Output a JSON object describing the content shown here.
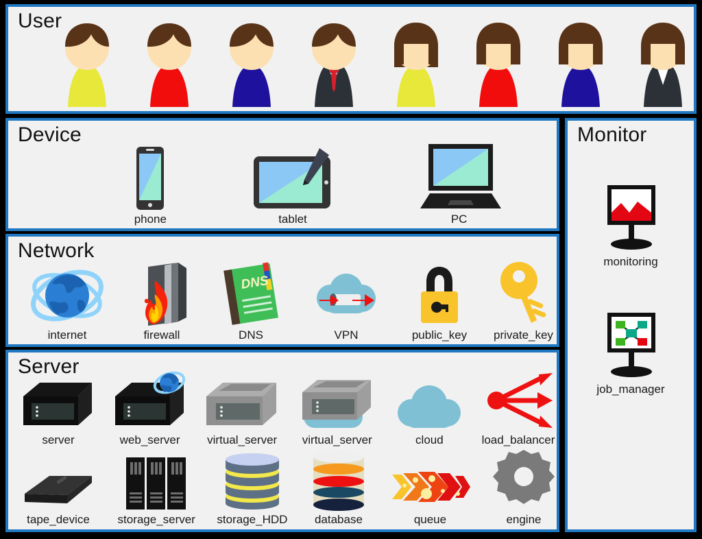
{
  "colors": {
    "background": "#000000",
    "panel_fill": "#F1F1F1",
    "panel_border": "#1F78C1",
    "label_text": "#1A1A1A",
    "skin": "#FCE0B2",
    "hair": "#593318",
    "shirt_yellow": "#E8E83A",
    "shirt_red": "#F20D0D",
    "shirt_blue": "#1E119E",
    "suit_dark": "#2B3137",
    "tie_red": "#D8202A",
    "screen_green": "#9BEBD2",
    "screen_blue": "#8CC8F5",
    "device_dark": "#333333",
    "key_yellow": "#F9C32B",
    "cloud_blue": "#7FC0D4",
    "arrow_red": "#EE1111",
    "gear_gray": "#7A7A7A",
    "hdd_slate": "#5D7085",
    "hdd_yellow": "#F2E84B",
    "chart_red": "#E30613",
    "node_green": "#3CB521",
    "node_teal": "#0BA888"
  },
  "panels": [
    {
      "id": "user",
      "title": "User"
    },
    {
      "id": "device",
      "title": "Device"
    },
    {
      "id": "network",
      "title": "Network"
    },
    {
      "id": "server",
      "title": "Server"
    },
    {
      "id": "monitor",
      "title": "Monitor"
    }
  ],
  "user": {
    "title": "User",
    "people": [
      {
        "icon": "user-male-yellow-icon",
        "gender": "male",
        "shirt": "#E8E83A",
        "label": ""
      },
      {
        "icon": "user-male-red-icon",
        "gender": "male",
        "shirt": "#F20D0D",
        "label": ""
      },
      {
        "icon": "user-male-blue-icon",
        "gender": "male",
        "shirt": "#1E119E",
        "label": ""
      },
      {
        "icon": "user-male-suit-icon",
        "gender": "male",
        "shirt": "#2B3137",
        "label": ""
      },
      {
        "icon": "user-female-yellow-icon",
        "gender": "female",
        "shirt": "#E8E83A",
        "label": ""
      },
      {
        "icon": "user-female-red-icon",
        "gender": "female",
        "shirt": "#F20D0D",
        "label": ""
      },
      {
        "icon": "user-female-blue-icon",
        "gender": "female",
        "shirt": "#1E119E",
        "label": ""
      },
      {
        "icon": "user-female-suit-icon",
        "gender": "female",
        "shirt": "#2B3137",
        "label": ""
      }
    ]
  },
  "device": {
    "title": "Device",
    "items": [
      {
        "icon": "phone-icon",
        "label": "phone"
      },
      {
        "icon": "tablet-icon",
        "label": "tablet"
      },
      {
        "icon": "pc-icon",
        "label": "PC"
      }
    ]
  },
  "network": {
    "title": "Network",
    "items": [
      {
        "icon": "internet-icon",
        "label": "internet"
      },
      {
        "icon": "firewall-icon",
        "label": "firewall"
      },
      {
        "icon": "dns-icon",
        "label": "DNS",
        "book_text": "DNS"
      },
      {
        "icon": "vpn-icon",
        "label": "VPN"
      },
      {
        "icon": "public-key-icon",
        "label": "public_key"
      },
      {
        "icon": "private-key-icon",
        "label": "private_key"
      }
    ]
  },
  "server": {
    "title": "Server",
    "row1": [
      {
        "icon": "server-icon",
        "label": "server"
      },
      {
        "icon": "web-server-icon",
        "label": "web_server"
      },
      {
        "icon": "virtual-server-icon",
        "label": "virtual_server"
      },
      {
        "icon": "virtual-server-cloud-icon",
        "label": "virtual_server"
      },
      {
        "icon": "cloud-icon",
        "label": "cloud"
      },
      {
        "icon": "load-balancer-icon",
        "label": "load_balancer"
      }
    ],
    "row2": [
      {
        "icon": "tape-device-icon",
        "label": "tape_device"
      },
      {
        "icon": "storage-server-icon",
        "label": "storage_server"
      },
      {
        "icon": "storage-hdd-icon",
        "label": "storage_HDD"
      },
      {
        "icon": "database-icon",
        "label": "database"
      },
      {
        "icon": "queue-icon",
        "label": "queue"
      },
      {
        "icon": "engine-icon",
        "label": "engine"
      }
    ]
  },
  "monitor": {
    "title": "Monitor",
    "items": [
      {
        "icon": "monitoring-icon",
        "label": "monitoring"
      },
      {
        "icon": "job-manager-icon",
        "label": "job_manager"
      }
    ]
  }
}
